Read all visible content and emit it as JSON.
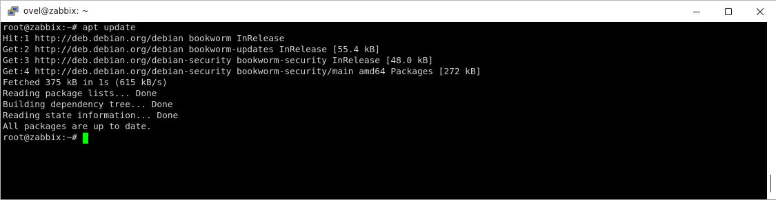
{
  "window": {
    "title": "ovel@zabbix: ~",
    "icon": "putty-icon",
    "controls": {
      "minimize": "minimize-icon",
      "maximize": "maximize-icon",
      "close": "close-icon"
    }
  },
  "terminal": {
    "background": "#000000",
    "text_color": "#cfcfcf",
    "cursor_color": "#00ff00",
    "lines": [
      "root@zabbix:~# apt update",
      "Hit:1 http://deb.debian.org/debian bookworm InRelease",
      "Get:2 http://deb.debian.org/debian bookworm-updates InRelease [55.4 kB]",
      "Get:3 http://deb.debian.org/debian-security bookworm-security InRelease [48.0 kB]",
      "Get:4 http://deb.debian.org/debian-security bookworm-security/main amd64 Packages [272 kB]",
      "Fetched 375 kB in 1s (615 kB/s)",
      "Reading package lists... Done",
      "Building dependency tree... Done",
      "Reading state information... Done",
      "All packages are up to date."
    ],
    "prompt": "root@zabbix:~#"
  }
}
